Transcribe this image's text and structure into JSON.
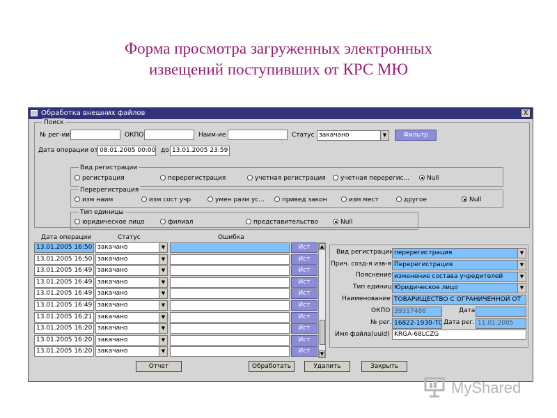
{
  "slide_title": {
    "line1": "Форма просмотра загруженных электронных",
    "line2": "извещений поступивших от КРС МЮ"
  },
  "window": {
    "title": "Обработка внешних файлов",
    "close_label": "X"
  },
  "search": {
    "group_label": "Поиск",
    "reg_num_label": "№ рег-ии",
    "reg_num_value": "",
    "okpo_label": "ОКПО",
    "okpo_value": "",
    "name_label": "Наим-ие",
    "name_value": "",
    "status_label": "Статус",
    "status_value": "закачано",
    "filter_button": "Фильтр",
    "date_from_label": "Дата операции от",
    "date_from_value": "08.01.2005 00:00",
    "date_to_label": "до",
    "date_to_value": "13.01.2005 23:59"
  },
  "reg_type": {
    "label": "Вид регистрации",
    "options": [
      "регистрация",
      "перерегистрация",
      "учетная регистрация",
      "учетная перерегис...",
      "Null"
    ],
    "selected": "Null"
  },
  "rereg": {
    "label": "Перерегистрация",
    "options": [
      "изм наим",
      "изм сост учр",
      "умен разм ус...",
      "привед закон",
      "изм мест",
      "другое",
      "Null"
    ],
    "selected": "Null"
  },
  "unit_type": {
    "label": "Тип единицы",
    "options": [
      "юридическое лицо",
      "филиал",
      "представительство",
      "Null"
    ],
    "selected": "Null"
  },
  "table": {
    "columns": [
      "Дата операции",
      "Статус",
      "Ошибка"
    ],
    "button_label": "Ист",
    "rows": [
      {
        "date": "13.01.2005 16:50",
        "status": "закачано",
        "error": ""
      },
      {
        "date": "13.01.2005 16:50",
        "status": "закачано",
        "error": ""
      },
      {
        "date": "13.01.2005 16:49",
        "status": "закачано",
        "error": ""
      },
      {
        "date": "13.01.2005 16:49",
        "status": "закачано",
        "error": ""
      },
      {
        "date": "13.01.2005 16:49",
        "status": "закачано",
        "error": ""
      },
      {
        "date": "13.01.2005 16:49",
        "status": "закачано",
        "error": ""
      },
      {
        "date": "13.01.2005 16:21",
        "status": "закачано",
        "error": ""
      },
      {
        "date": "13.01.2005 16:20",
        "status": "закачано",
        "error": ""
      },
      {
        "date": "13.01.2005 16:20",
        "status": "закачано",
        "error": ""
      },
      {
        "date": "13.01.2005 16:20",
        "status": "закачано",
        "error": ""
      }
    ]
  },
  "details": {
    "reg_type_label": "Вид регистрации",
    "reg_type_value": "перерегистрация",
    "reason_label": "Прич. созд-я изв-я",
    "reason_value": "Перерегистрация",
    "note_label": "Пояснение",
    "note_value": "изменение состава учредителей",
    "unit_label": "Тип единицы",
    "unit_value": "Юридическое лицо",
    "name_label": "Наименование",
    "name_value": "ТОВАРИЩЕСТВО С ОГРАНИЧЕННОЙ ОТ",
    "okpo_label": "ОКПО",
    "okpo_value": "39317486",
    "date_label": "Дата",
    "date_value": "",
    "reg_num_label": "№ рег.",
    "reg_num_value": "16822-1930-ТО",
    "reg_date_label": "Дата рег.",
    "reg_date_value": "11.01.2005",
    "file_label": "Имя файла(uuid)",
    "file_value": "KRGA-68LCZG"
  },
  "actions": {
    "report": "Отчет",
    "process": "Обработать",
    "delete": "Удалить",
    "close": "Закрыть"
  },
  "watermark": {
    "text": "MyShared"
  }
}
